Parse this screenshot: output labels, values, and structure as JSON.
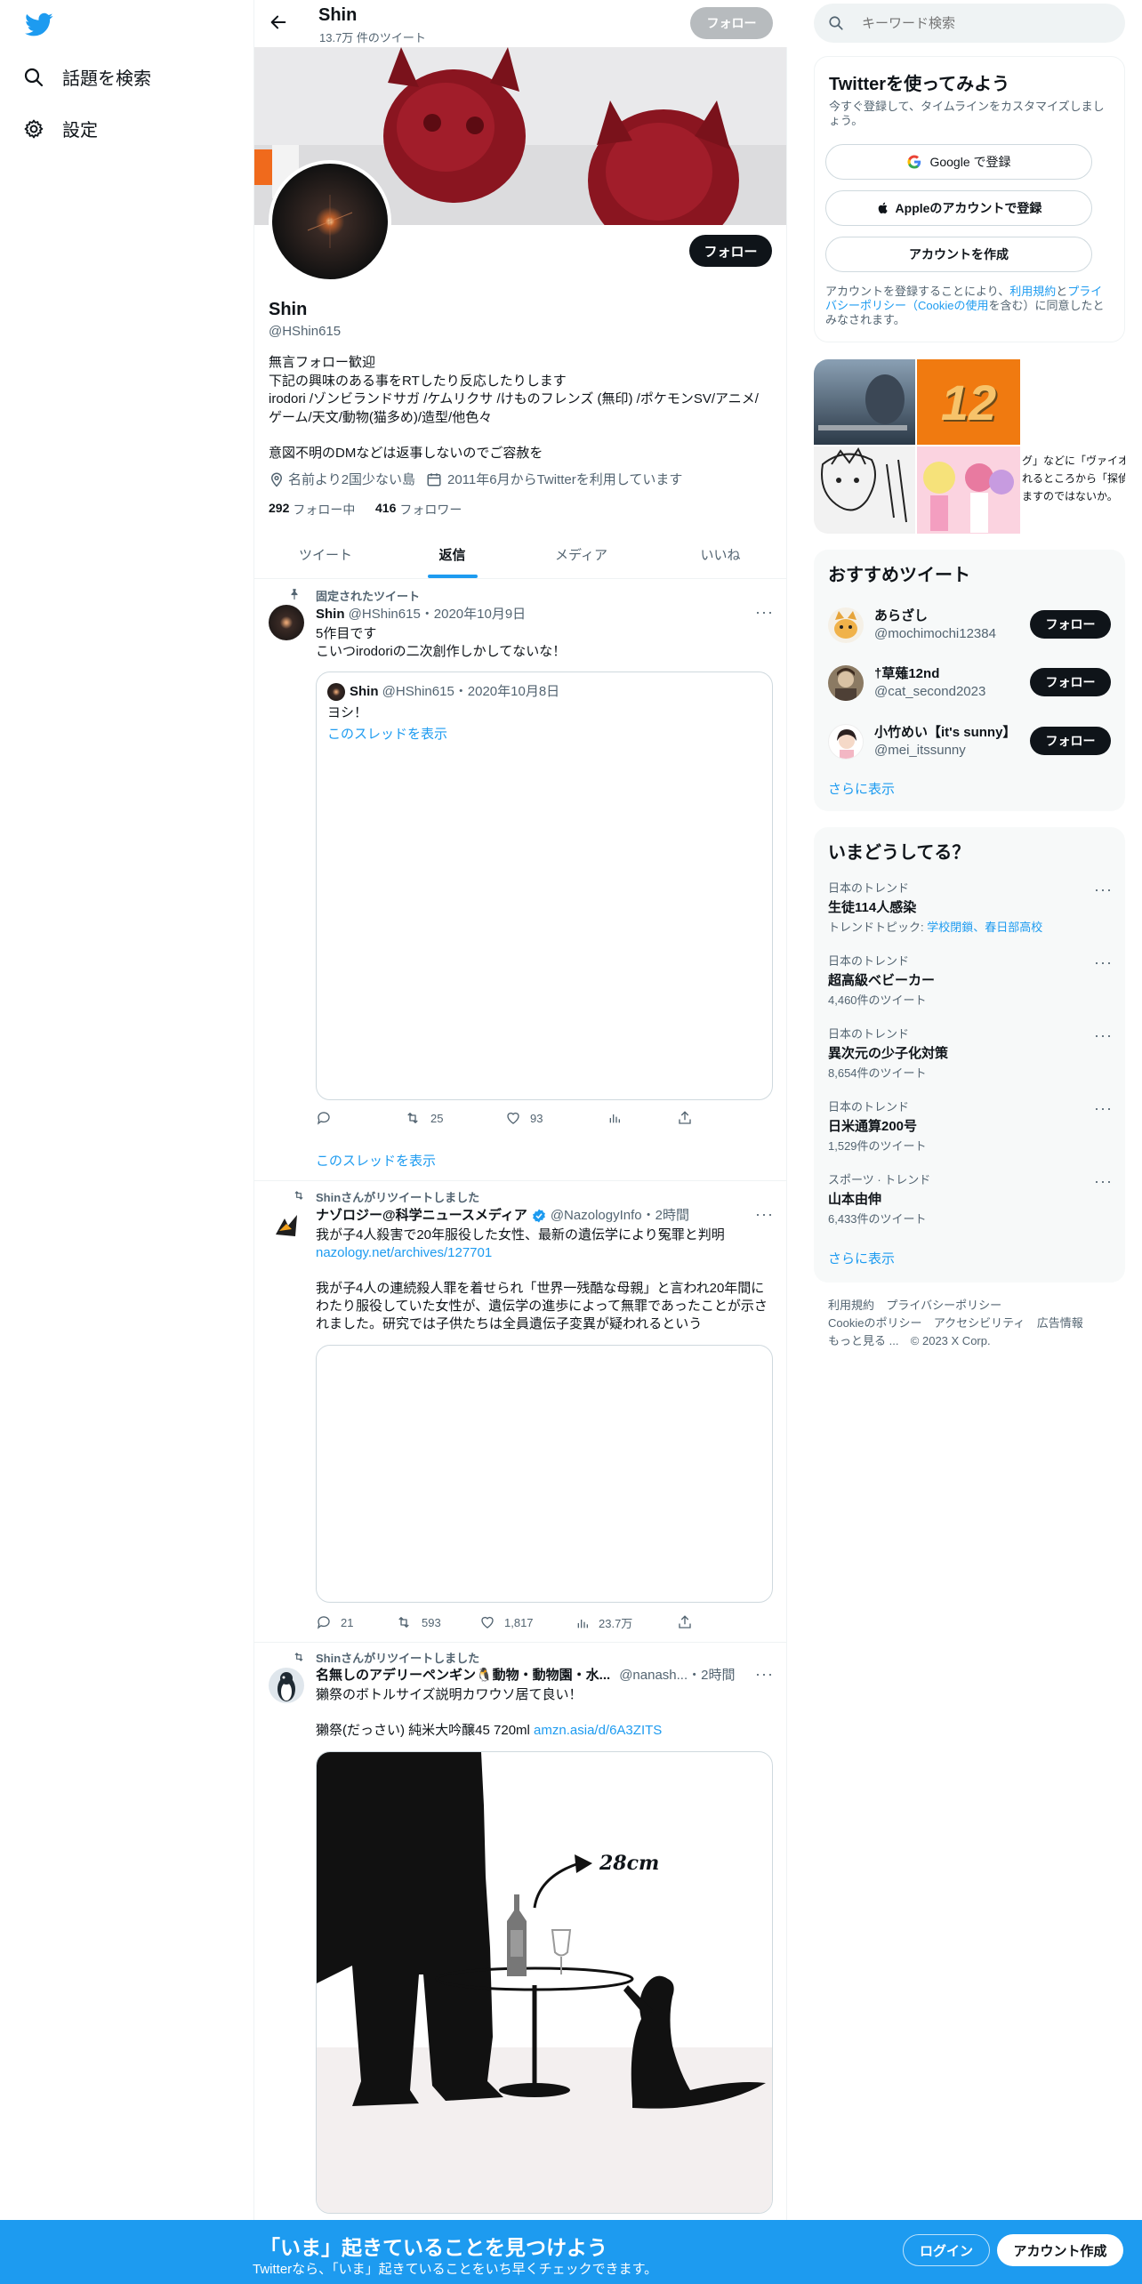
{
  "nav": {
    "explore": "話題を検索",
    "settings": "設定"
  },
  "header": {
    "name": "Shin",
    "tweet_count": "13.7万 件のツイート",
    "follow": "フォロー"
  },
  "profile": {
    "name": "Shin",
    "handle": "@HShin615",
    "follow": "フォロー",
    "bio": [
      "無言フォロー歓迎",
      "下記の興味のある事をRTしたり反応したりします",
      "irodori /ゾンビランドサガ /ケムリクサ /けものフレンズ (無印) /ポケモンSV/アニメ/",
      "ゲーム/天文/動物(猫多め)/造型/他色々",
      "",
      "意図不明のDMなどは返事しないのでご容赦を"
    ],
    "location": "名前より2国少ない島",
    "joined": "2011年6月からTwitterを利用しています",
    "following_count": "292",
    "following_label": "フォロー中",
    "followers_count": "416",
    "followers_label": "フォロワー"
  },
  "tabs": [
    "ツイート",
    "返信",
    "メディア",
    "いいね"
  ],
  "tweets": [
    {
      "context": "固定されたツイート",
      "name": "Shin",
      "meta": "@HShin615・2020年10月9日",
      "text": [
        "5作目です",
        "こいつirodoriの二次創作しかしてないな！"
      ],
      "quote": {
        "name": "Shin",
        "meta": "@HShin615・2020年10月8日",
        "text": "ヨシ！",
        "link": "このスレッドを表示"
      },
      "retweets": "25",
      "likes": "93",
      "show_thread": "このスレッドを表示"
    },
    {
      "context": "Shinさんがリツイートしました",
      "name": "ナゾロジー@科学ニュースメディア",
      "meta": "@NazologyInfo・2時間",
      "text": [
        "我が子4人殺害で20年服役した女性、最新の遺伝学により冤罪と判明"
      ],
      "link": "nazology.net/archives/127701",
      "body": [
        "我が子4人の連続殺人罪を着せられ「世界一残酷な母親」と言われ20年間に",
        "わたり服役していた女性が、遺伝学の進歩によって無罪であったことが示さ",
        "れました。研究では子供たちは全員遺伝子変異が疑われるという"
      ],
      "replies": "21",
      "retweets": "593",
      "likes": "1,817",
      "views": "23.7万"
    },
    {
      "context": "Shinさんがリツイートしました",
      "name": "名無しのアデリーペンギン🐧動物・動物園・水...",
      "meta": "@nanash...・2時間",
      "text": [
        "獺祭のボトルサイズ説明カワウソ居て良い！"
      ],
      "text2": "獺祭(だっさい) 純米大吟醸45 720ml ",
      "link": "amzn.asia/d/6A3ZITS",
      "image_label": "28cm"
    }
  ],
  "search": {
    "placeholder": "キーワード検索"
  },
  "signup": {
    "title": "Twitterを使ってみよう",
    "subtitle": "今すぐ登録して、タイムラインをカスタマイズしましょう。",
    "google": "Google で登録",
    "apple": "Appleのアカウントで登録",
    "create": "アカウントを作成",
    "terms_prefix": "アカウントを登録することにより、",
    "terms_link": "利用規約",
    "and": "と",
    "privacy_link": "プライバシーポリシー",
    "cookie_open": "（",
    "cookie_link": "Cookieの使用",
    "cookie_close": "を含む）に同意したとみなされます。"
  },
  "media_grid": {
    "tile2": "12",
    "tile3_text": [
      "グ」などに「ヴァイオ",
      "れるところから「探偵",
      "ますのではないか。"
    ]
  },
  "recommended": {
    "title": "おすすめツイート",
    "users": [
      {
        "name": "あらざし",
        "handle": "@mochimochi12384",
        "follow": "フォロー"
      },
      {
        "name": "†草薙12nd",
        "handle": "@cat_second2023",
        "follow": "フォロー"
      },
      {
        "name": "小竹めい【it's sunny】",
        "handle": "@mei_itssunny",
        "follow": "フォロー"
      }
    ],
    "more": "さらに表示"
  },
  "trends": {
    "title": "いまどうしてる？",
    "items": [
      {
        "category": "日本のトレンド",
        "name": "生徒114人感染",
        "sub_prefix": "トレンドトピック: ",
        "sub_link": "学校閉鎖、春日部高校"
      },
      {
        "category": "日本のトレンド",
        "name": "超高級ベビーカー",
        "count": "4,460件のツイート"
      },
      {
        "category": "日本のトレンド",
        "name": "異次元の少子化対策",
        "count": "8,654件のツイート"
      },
      {
        "category": "日本のトレンド",
        "name": "日米通算200号",
        "count": "1,529件のツイート"
      },
      {
        "category": "スポーツ · トレンド",
        "name": "山本由伸",
        "count": "6,433件のツイート"
      }
    ],
    "more": "さらに表示"
  },
  "footer": {
    "terms": "利用規約",
    "privacy": "プライバシーポリシー",
    "cookie": "Cookieのポリシー",
    "accessibility": "アクセシビリティ",
    "ads": "広告情報",
    "more": "もっと見る ...",
    "copyright": "© 2023 X Corp."
  },
  "bottom": {
    "title": "「いま」起きていることを見つけよう",
    "subtitle": "Twitterなら、「いま」起きていることをいち早くチェックできます。",
    "login": "ログイン",
    "signup": "アカウント作成"
  },
  "colors": {
    "accent": "#1d9bf0",
    "text": "#0f1419",
    "secondary": "#536471",
    "verified": "#1d9bf0"
  }
}
